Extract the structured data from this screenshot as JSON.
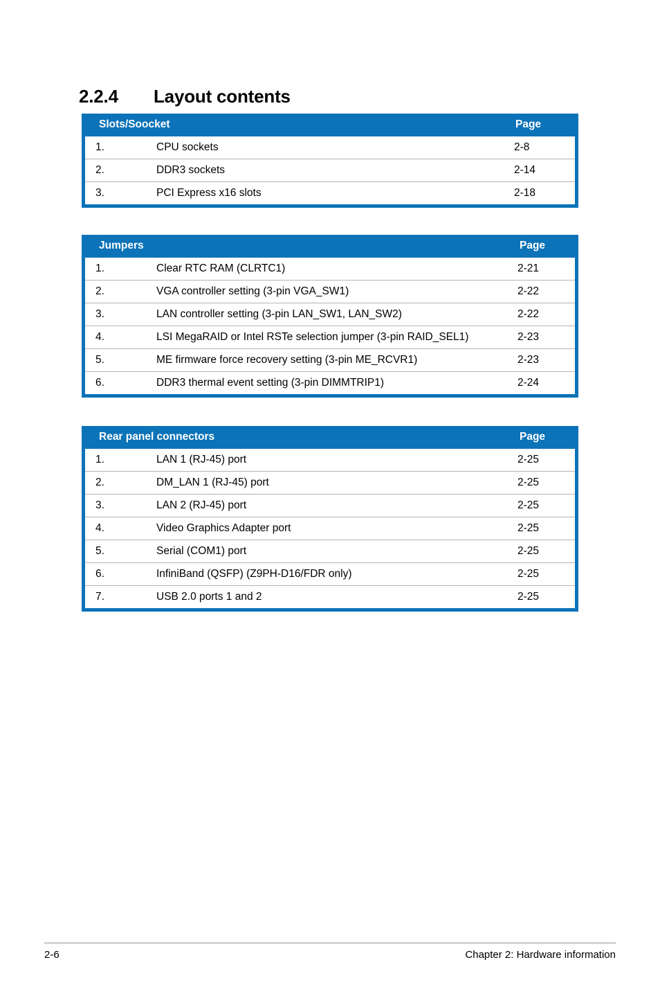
{
  "heading": {
    "number": "2.2.4",
    "title": "Layout contents"
  },
  "colors": {
    "table_blue": "#0c73b8",
    "row_separator": "#b3b3b3",
    "footer_rule": "#d4d4d4"
  },
  "tables": [
    {
      "id": "slots-soocket",
      "header_label": "Slots/Soocket",
      "header_page": "Page",
      "rows": [
        {
          "num": "1.",
          "text": "CPU sockets",
          "page": "2-8"
        },
        {
          "num": "2.",
          "text": "DDR3 sockets",
          "page": "2-14"
        },
        {
          "num": "3.",
          "text": "PCI Express x16 slots",
          "page": "2-18"
        }
      ]
    },
    {
      "id": "jumpers",
      "header_label": "Jumpers",
      "header_page": "Page",
      "rows": [
        {
          "num": "1.",
          "text": "Clear RTC RAM (CLRTC1)",
          "page": "2-21"
        },
        {
          "num": "2.",
          "text": "VGA controller setting (3-pin VGA_SW1)",
          "page": "2-22"
        },
        {
          "num": "3.",
          "text": "LAN controller setting (3-pin LAN_SW1, LAN_SW2)",
          "page": "2-22"
        },
        {
          "num": "4.",
          "text": "LSI MegaRAID or Intel RSTe selection jumper  (3-pin RAID_SEL1)",
          "page": "2-23"
        },
        {
          "num": "5.",
          "text": "ME firmware force recovery setting (3-pin ME_RCVR1)",
          "page": "2-23"
        },
        {
          "num": "6.",
          "text": "DDR3 thermal event setting (3-pin DIMMTRIP1)",
          "page": "2-24"
        }
      ]
    },
    {
      "id": "rear-panel-connectors",
      "header_label": "Rear panel connectors",
      "header_page": "Page",
      "rows": [
        {
          "num": "1.",
          "text": "LAN 1 (RJ-45) port",
          "page": "2-25"
        },
        {
          "num": "2.",
          "text": "DM_LAN 1 (RJ-45) port",
          "page": "2-25"
        },
        {
          "num": "3.",
          "text": "LAN 2 (RJ-45) port",
          "page": "2-25"
        },
        {
          "num": "4.",
          "text": "Video Graphics Adapter port",
          "page": "2-25"
        },
        {
          "num": "5.",
          "text": "Serial (COM1) port",
          "page": "2-25"
        },
        {
          "num": "6.",
          "text": "InfiniBand (QSFP) (Z9PH-D16/FDR only)",
          "page": "2-25"
        },
        {
          "num": "7.",
          "text": "USB 2.0 ports 1 and 2",
          "page": "2-25"
        }
      ]
    }
  ],
  "footer": {
    "page_number": "2-6",
    "chapter": "Chapter 2: Hardware information"
  }
}
